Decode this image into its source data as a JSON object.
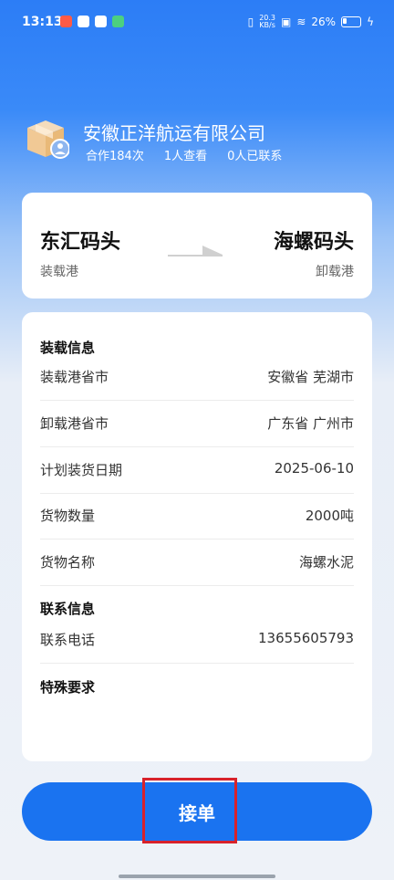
{
  "status": {
    "time": "13:13",
    "net_speed_top": "20.3",
    "net_speed_bottom": "KB/s",
    "battery": "26%"
  },
  "company": {
    "name": "安徽正洋航运有限公司",
    "cooperation": "合作184次",
    "viewers": "1人查看",
    "contacted": "0人已联系"
  },
  "route": {
    "load_port": "东汇码头",
    "load_label": "装载港",
    "unload_port": "海螺码头",
    "unload_label": "卸载港"
  },
  "loading_info": {
    "section_title": "装载信息",
    "rows": [
      {
        "label": "装载港省市",
        "value": "安徽省 芜湖市"
      },
      {
        "label": "卸载港省市",
        "value": "广东省 广州市"
      },
      {
        "label": "计划装货日期",
        "value": "2025-06-10"
      },
      {
        "label": "货物数量",
        "value": "2000吨"
      },
      {
        "label": "货物名称",
        "value": "海螺水泥"
      }
    ]
  },
  "contact_info": {
    "section_title": "联系信息",
    "phone_label": "联系电话",
    "phone": "13655605793"
  },
  "special": {
    "section_title": "特殊要求"
  },
  "action": {
    "accept_label": "接单"
  },
  "colors": {
    "accent": "#1a73f0",
    "highlight": "#d8222b"
  }
}
